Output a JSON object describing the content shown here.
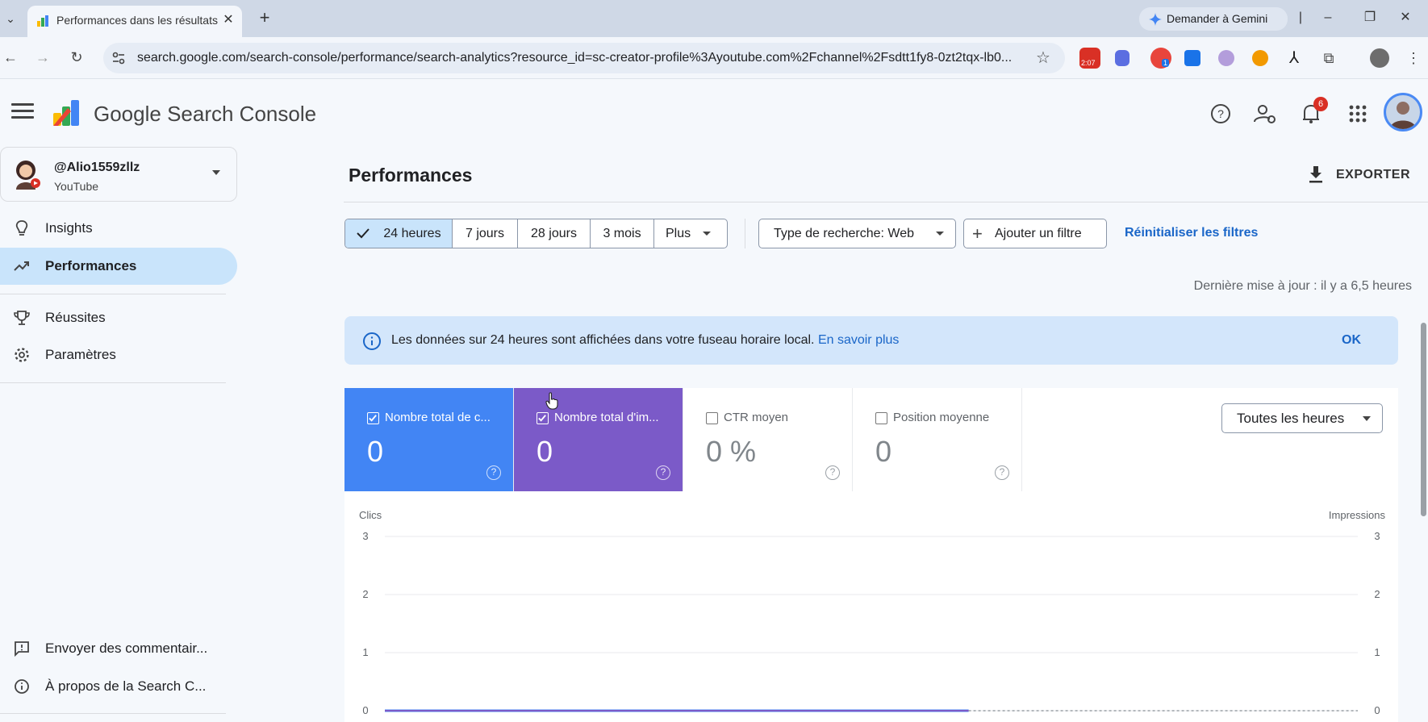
{
  "browser": {
    "tab_title": "Performances dans les résultats",
    "gemini_label": "Demander à Gemini",
    "url": "search.google.com/search-console/performance/search-analytics?resource_id=sc-creator-profile%3Ayoutube.com%2Fchannel%2Fsdtt1fy8-0zt2tqx-lb0...",
    "extension_badges": [
      "2:07",
      "1"
    ]
  },
  "header": {
    "app_title": "Google Search Console",
    "notification_count": "6"
  },
  "sidebar": {
    "property_name": "@Alio1559zllz",
    "property_type": "YouTube",
    "items": [
      {
        "label": "Insights",
        "icon": "lightbulb-icon"
      },
      {
        "label": "Performances",
        "icon": "trending-up-icon"
      },
      {
        "label": "Réussites",
        "icon": "trophy-icon"
      },
      {
        "label": "Paramètres",
        "icon": "gear-icon"
      }
    ],
    "footer": [
      {
        "label": "Envoyer des commentair...",
        "icon": "feedback-icon"
      },
      {
        "label": "À propos de la Search C...",
        "icon": "info-icon"
      }
    ]
  },
  "main": {
    "title": "Performances",
    "export_label": "EXPORTER",
    "ranges": [
      "24 heures",
      "7 jours",
      "28 jours",
      "3 mois",
      "Plus"
    ],
    "selected_range": "24 heures",
    "search_type": "Type de recherche: Web",
    "add_filter": "Ajouter un filtre",
    "reset_filters": "Réinitialiser les filtres",
    "last_update": "Dernière mise à jour : il y a 6,5 heures",
    "banner": {
      "text": "Les données sur 24 heures sont affichées dans votre fuseau horaire local.",
      "link": "En savoir plus",
      "ok": "OK"
    },
    "metrics": [
      {
        "label": "Nombre total de c...",
        "value": "0",
        "checked": true,
        "color": "#4285f4"
      },
      {
        "label": "Nombre total d'im...",
        "value": "0",
        "checked": true,
        "color": "#7b5ac8"
      },
      {
        "label": "CTR moyen",
        "value": "0 %",
        "checked": false
      },
      {
        "label": "Position moyenne",
        "value": "0",
        "checked": false
      }
    ],
    "hours_select": "Toutes les heures"
  },
  "chart_data": {
    "type": "line",
    "ylabel_left": "Clics",
    "ylabel_right": "Impressions",
    "yticks_left": [
      "3",
      "2",
      "1",
      "0"
    ],
    "yticks_right": [
      "3",
      "2",
      "1",
      "0"
    ],
    "ylim": [
      0,
      3
    ],
    "series": [
      {
        "name": "Clics",
        "values": [
          0,
          0
        ],
        "color": "#4285f4"
      },
      {
        "name": "Impressions",
        "values": [
          0,
          0
        ],
        "color": "#7b5ac8"
      }
    ]
  }
}
